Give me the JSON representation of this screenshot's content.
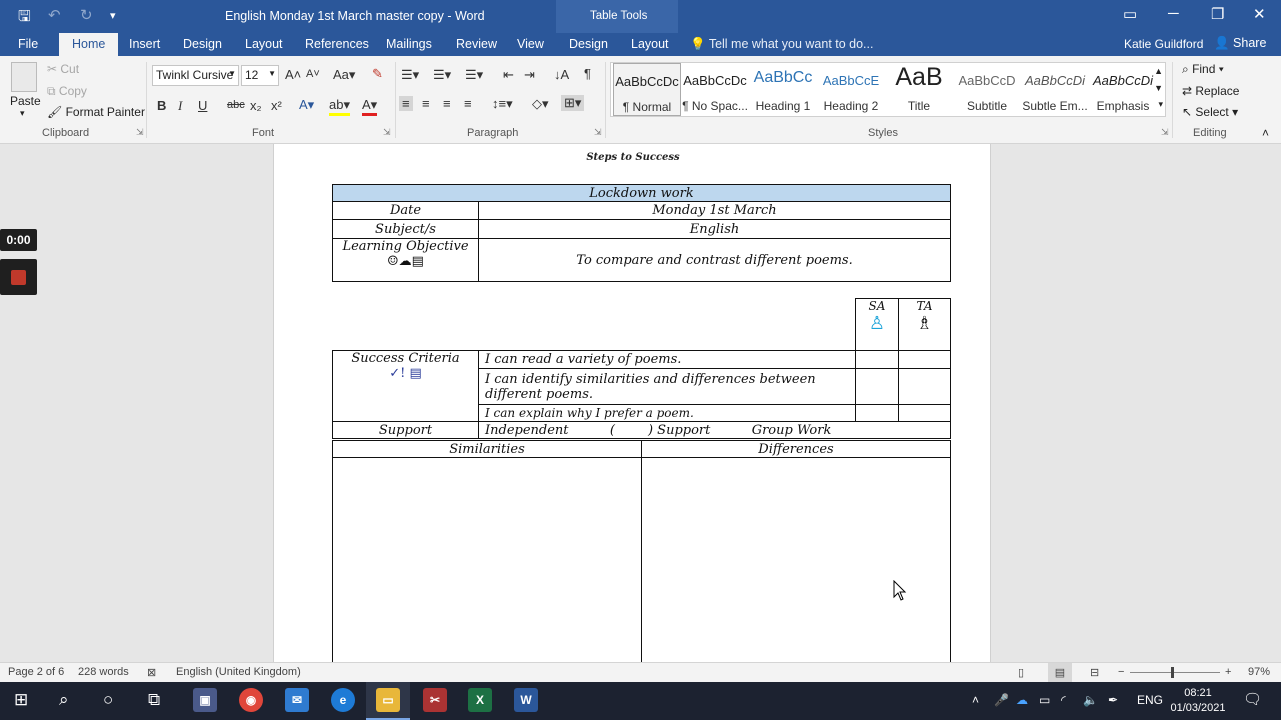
{
  "window": {
    "title": "English Monday 1st March master copy - Word",
    "context_tab_group": "Table Tools",
    "user": "Katie Guildford",
    "share": "Share",
    "tell_me": "Tell me what you want to do..."
  },
  "tabs": [
    "File",
    "Home",
    "Insert",
    "Design",
    "Layout",
    "References",
    "Mailings",
    "Review",
    "View",
    "Design",
    "Layout"
  ],
  "ribbon": {
    "clipboard": {
      "paste": "Paste",
      "cut": "Cut",
      "copy": "Copy",
      "format_painter": "Format Painter",
      "label": "Clipboard"
    },
    "font": {
      "name": "Twinkl Cursive",
      "size": "12",
      "label": "Font",
      "bold": "B",
      "italic": "I",
      "underline": "U",
      "strike": "abc",
      "sub": "x₂",
      "sup": "x²"
    },
    "paragraph": {
      "label": "Paragraph"
    },
    "styles": {
      "label": "Styles",
      "items": [
        {
          "preview": "AaBbCcDc",
          "name": "¶ Normal"
        },
        {
          "preview": "AaBbCcDc",
          "name": "¶ No Spac..."
        },
        {
          "preview": "AaBbCc",
          "name": "Heading 1"
        },
        {
          "preview": "AaBbCcE",
          "name": "Heading 2"
        },
        {
          "preview": "AaB",
          "name": "Title"
        },
        {
          "preview": "AaBbCcD",
          "name": "Subtitle"
        },
        {
          "preview": "AaBbCcDi",
          "name": "Subtle Em..."
        },
        {
          "preview": "AaBbCcDi",
          "name": "Emphasis"
        }
      ]
    },
    "editing": {
      "find": "Find",
      "replace": "Replace",
      "select": "Select",
      "label": "Editing"
    }
  },
  "recorder": {
    "time": "0:00"
  },
  "document": {
    "heading": "Steps to Success",
    "table1": {
      "header": "Lockdown work",
      "rows": [
        {
          "label": "Date",
          "value": "Monday 1st March"
        },
        {
          "label": "Subject/s",
          "value": "English"
        },
        {
          "label": "Learning Objective",
          "value": "To compare and contrast different poems."
        }
      ]
    },
    "assessment": {
      "sa": "SA",
      "ta": "TA"
    },
    "success": {
      "label": "Success Criteria",
      "items": [
        "I can read a variety of poems.",
        "I can identify similarities and differences between different poems.",
        "I can explain why I prefer a poem."
      ]
    },
    "support": {
      "label": "Support",
      "options": "Independent          (        ) Support          Group Work"
    },
    "compare": {
      "left": "Similarities",
      "right": "Differences"
    }
  },
  "status": {
    "page": "Page 2 of 6",
    "words": "228 words",
    "language": "English (United Kingdom)",
    "zoom": "97%"
  },
  "taskbar": {
    "lang": "ENG",
    "time": "08:21",
    "date": "01/03/2021"
  }
}
